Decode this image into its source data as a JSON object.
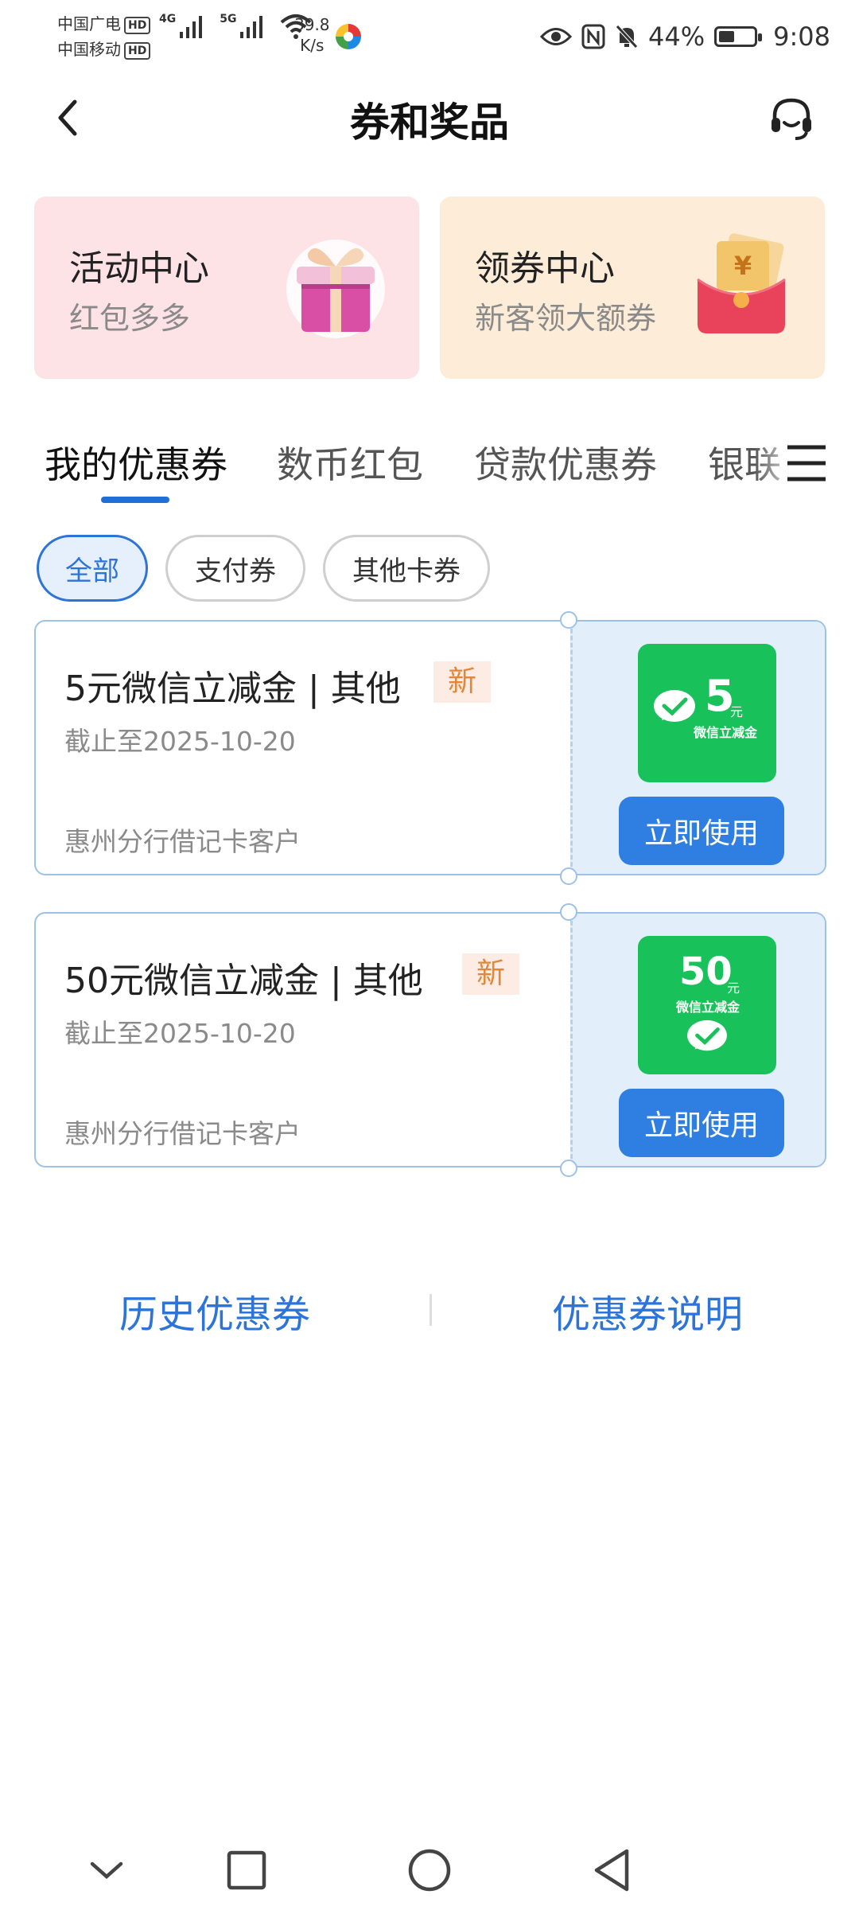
{
  "status_bar": {
    "carrier1": "中国广电",
    "carrier2": "中国移动",
    "hd_badge": "HD",
    "net1": "4G",
    "net2": "5G",
    "speed_value": "39.8",
    "speed_unit": "K/s",
    "battery_percent": "44%",
    "time": "9:08",
    "icons": [
      "eye-icon",
      "nfc-icon",
      "mute-bell-icon",
      "battery-icon"
    ]
  },
  "header": {
    "title": "券和奖品",
    "back_icon": "chevron-left-icon",
    "service_icon": "headset-icon"
  },
  "promo_cards": [
    {
      "title": "活动中心",
      "subtitle": "红包多多",
      "icon": "gift-box-icon"
    },
    {
      "title": "领券中心",
      "subtitle": "新客领大额券",
      "icon": "red-envelope-icon"
    }
  ],
  "tabs": [
    {
      "label": "我的优惠券",
      "active": true
    },
    {
      "label": "数币红包",
      "active": false
    },
    {
      "label": "贷款优惠券",
      "active": false
    },
    {
      "label": "银联",
      "active": false
    }
  ],
  "filters": [
    {
      "label": "全部",
      "active": true
    },
    {
      "label": "支付券",
      "active": false
    },
    {
      "label": "其他卡券",
      "active": false
    }
  ],
  "coupons": [
    {
      "title": "5元微信立减金 | 其他",
      "badge": "新",
      "date": "截止至2025-10-20",
      "org": "惠州分行借记卡客户",
      "logo_amount": "5",
      "logo_unit": "元",
      "logo_caption": "微信立减金",
      "action": "立即使用"
    },
    {
      "title": "50元微信立减金 | 其他",
      "badge": "新",
      "date": "截止至2025-10-20",
      "org": "惠州分行借记卡客户",
      "logo_amount": "50",
      "logo_unit": "元",
      "logo_caption": "微信立减金",
      "action": "立即使用"
    }
  ],
  "footer_links": {
    "history": "历史优惠券",
    "explain": "优惠券说明"
  },
  "colors": {
    "primary": "#2f7fe2",
    "wechat_green": "#19c15a",
    "badge_orange": "#e0873b"
  }
}
